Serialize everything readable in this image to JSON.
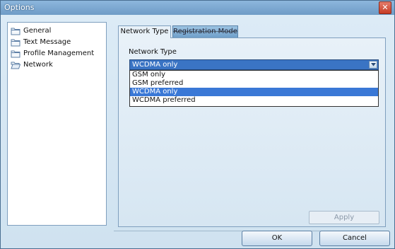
{
  "window": {
    "title": "Options",
    "close_glyph": "✕"
  },
  "tree": {
    "items": [
      {
        "label": "General",
        "icon": "folder-icon"
      },
      {
        "label": "Text Message",
        "icon": "folder-icon"
      },
      {
        "label": "Profile Management",
        "icon": "folder-icon"
      },
      {
        "label": "Network",
        "icon": "folder-open-icon"
      }
    ]
  },
  "tabs": [
    {
      "label": "Network Type",
      "active": true
    },
    {
      "label": "Registration Mode",
      "active": false
    }
  ],
  "network_type": {
    "label": "Network Type",
    "selected_value": "WCDMA only",
    "options": [
      "GSM only",
      "GSM preferred",
      "WCDMA only",
      "WCDMA preferred"
    ],
    "highlighted_option": "WCDMA only"
  },
  "buttons": {
    "apply": "Apply",
    "ok": "OK",
    "cancel": "Cancel"
  },
  "colors": {
    "selection": "#3a78d6",
    "window_bg": "#c8dcec",
    "close_red": "#c63c25"
  }
}
